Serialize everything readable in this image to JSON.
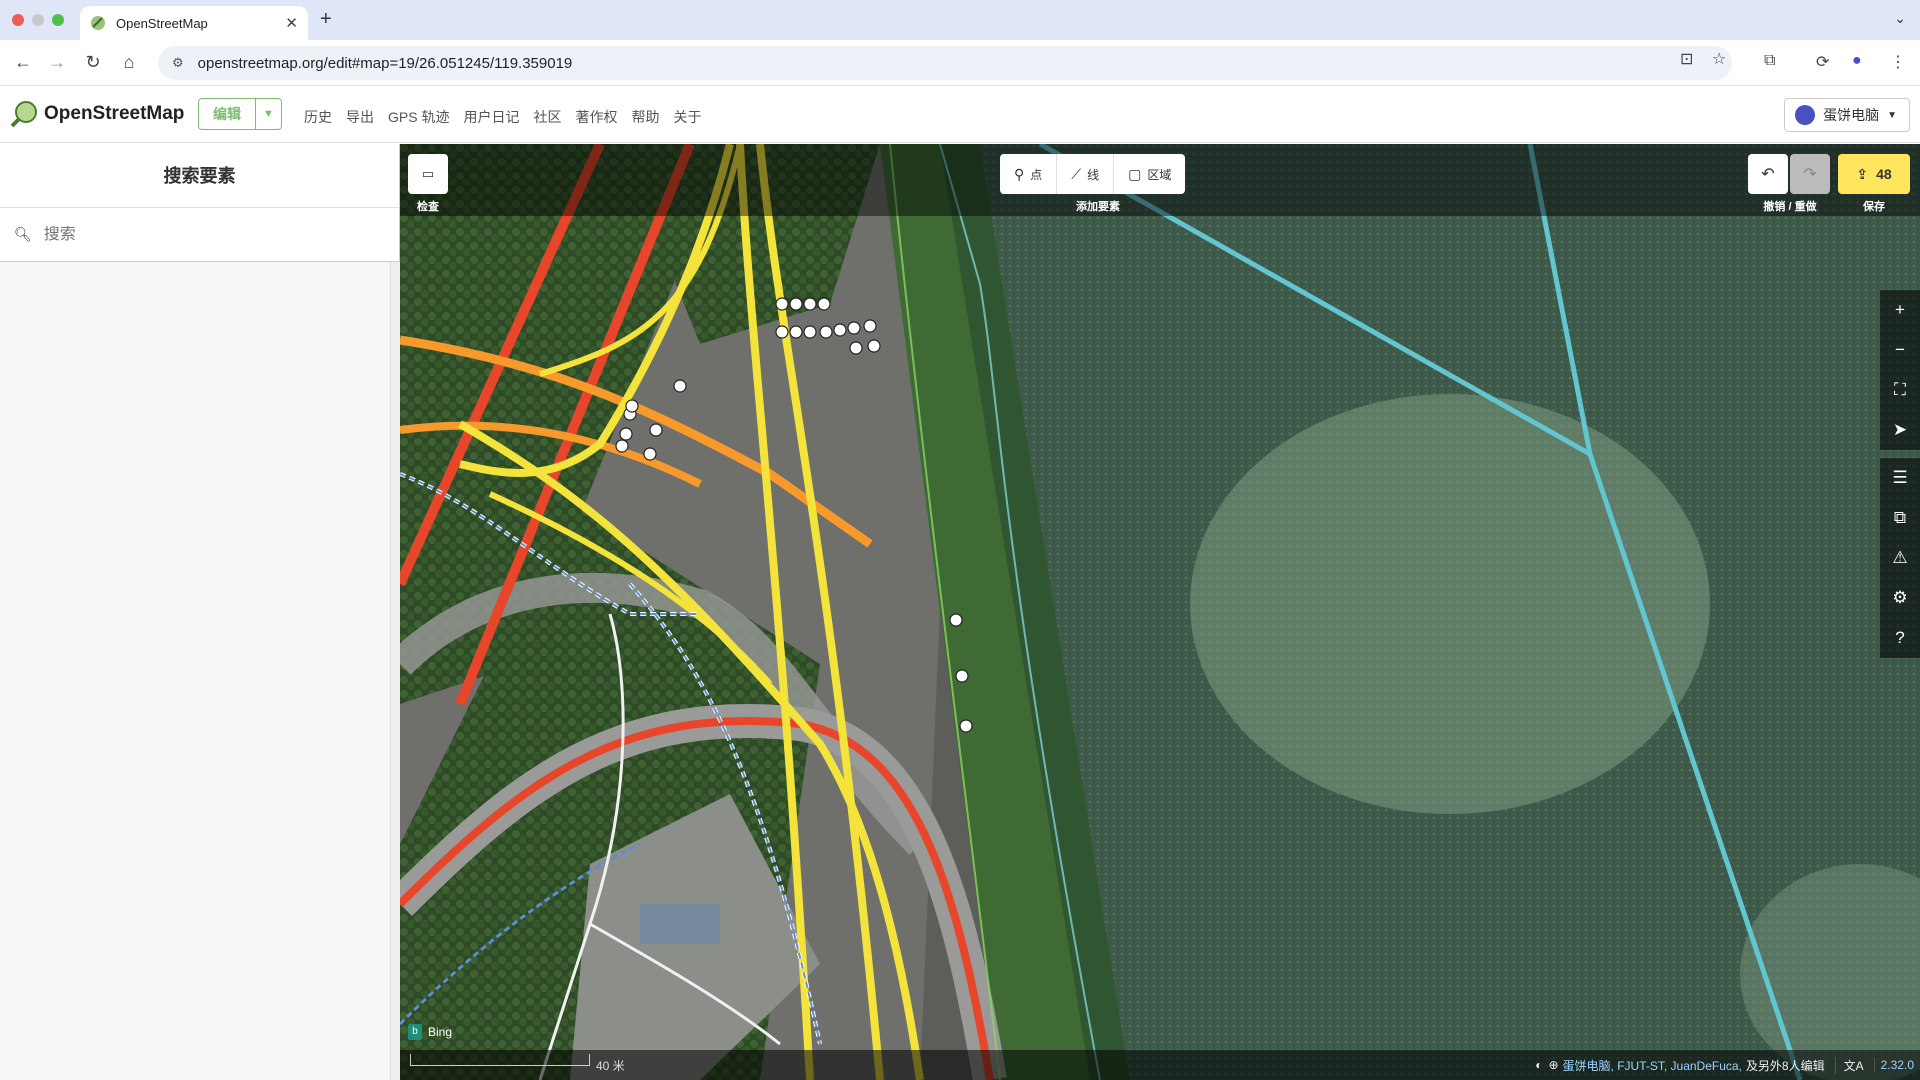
{
  "browser": {
    "tab_title": "OpenStreetMap",
    "url": "openstreetmap.org/edit#map=19/26.051245/119.359019"
  },
  "header": {
    "logo": "OpenStreetMap",
    "edit_label": "编辑",
    "nav": [
      "历史",
      "导出",
      "GPS 轨迹",
      "用户日记",
      "社区",
      "著作权",
      "帮助",
      "关于"
    ],
    "user": "蛋饼电脑"
  },
  "sidebar": {
    "title": "搜索要素",
    "search_placeholder": "搜索"
  },
  "map": {
    "inspect_label": "检查",
    "add_point": "点",
    "add_line": "线",
    "add_area": "区域",
    "add_feature_label": "添加要素",
    "undo_redo_label": "撤销 / 重做",
    "save_label": "保存",
    "save_count": "48",
    "imagery": "Bing",
    "scale": "40 米",
    "attribution_users": "蛋饼电脑, FJUT-ST, JuanDeFuca,",
    "attribution_more": "及另外8人编辑",
    "lang": "A",
    "version": "2.32.0"
  },
  "colors": {
    "primary_road": "#e8462a",
    "secondary_road": "#f7992b",
    "tertiary_road": "#f3e33a",
    "river": "#63c5cf",
    "osm_green": "#7ebc6f",
    "save_yellow": "#ffe55c"
  }
}
